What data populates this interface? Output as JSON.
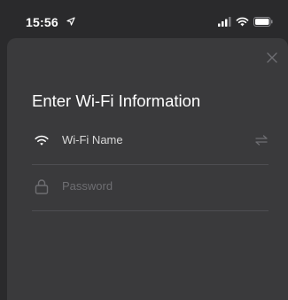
{
  "status_bar": {
    "time": "15:56",
    "icons": [
      "location-arrow-icon",
      "cellular-signal-icon",
      "wifi-icon",
      "battery-icon"
    ]
  },
  "sheet": {
    "title": "Enter Wi-Fi Information",
    "close_icon": "close-icon",
    "wifi_row": {
      "icon": "wifi-icon",
      "label": "Wi-Fi Name",
      "action_icon": "swap-arrows-icon"
    },
    "password_row": {
      "icon": "lock-icon",
      "placeholder": "Password"
    }
  },
  "colors": {
    "background": "#2a2a2c",
    "sheet": "#3a3a3c",
    "divider": "#4e4e52",
    "placeholder": "#6e6e72"
  }
}
